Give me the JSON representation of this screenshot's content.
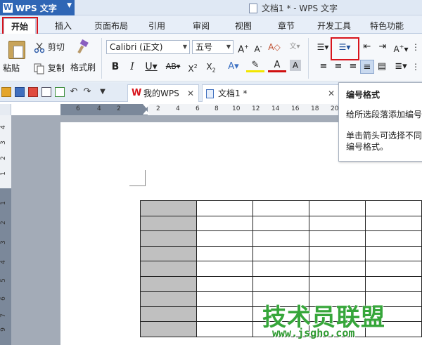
{
  "app": {
    "brand": "WPS 文字",
    "window_title": "文档1 * - WPS 文字"
  },
  "ribbon_tabs": [
    {
      "label": "开始",
      "active": true
    },
    {
      "label": "插入"
    },
    {
      "label": "页面布局"
    },
    {
      "label": "引用"
    },
    {
      "label": "审阅"
    },
    {
      "label": "视图"
    },
    {
      "label": "章节"
    },
    {
      "label": "开发工具"
    },
    {
      "label": "特色功能"
    }
  ],
  "clipboard": {
    "paste": "粘贴",
    "cut": "剪切",
    "copy": "复制",
    "format_painter": "格式刷"
  },
  "font": {
    "name": "Calibri (正文)",
    "size": "五号"
  },
  "doc_tabs": [
    {
      "label": "我的WPS"
    },
    {
      "label": "文档1 *"
    }
  ],
  "tooltip": {
    "title": "编号格式",
    "line1": "给所选段落添加编号",
    "line2": "单击箭头可选择不同",
    "line3": "编号格式。"
  },
  "ruler": {
    "h_ticks": [
      "6",
      "4",
      "2",
      "2",
      "4",
      "6",
      "8",
      "10",
      "12",
      "14",
      "16",
      "18",
      "20",
      "22"
    ],
    "v_ticks": [
      "4",
      "3",
      "2",
      "1",
      "1",
      "2",
      "3",
      "4",
      "5",
      "6",
      "7",
      "8",
      "9",
      "10"
    ]
  },
  "table": {
    "rows": 9,
    "cols": 5
  },
  "watermark": {
    "text": "技术员联盟",
    "url": "www.jsgho.com"
  },
  "colors": {
    "highlight": "#d8141c",
    "brand": "#2f66b5",
    "watermark": "#36a63a"
  }
}
